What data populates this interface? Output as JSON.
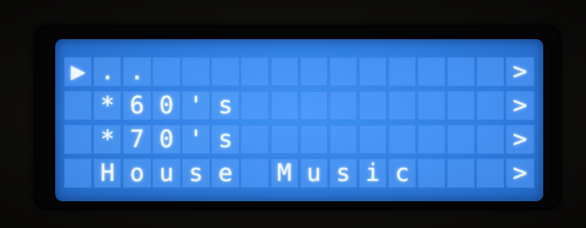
{
  "display": {
    "rows": [
      {
        "cursor": "▶",
        "label": "..",
        "arrow": ">"
      },
      {
        "cursor": "",
        "label": "*60's",
        "arrow": ">"
      },
      {
        "cursor": "",
        "label": "*70's",
        "arrow": ">"
      },
      {
        "cursor": "",
        "label": "House Music",
        "arrow": ">"
      }
    ],
    "columns": 16,
    "selected_row": 0,
    "colors": {
      "backlight": "#3f93f4",
      "text": "#eef6ff"
    }
  }
}
